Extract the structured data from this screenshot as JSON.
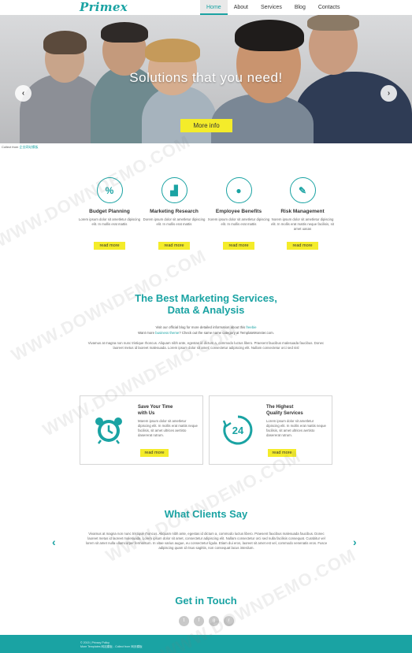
{
  "header": {
    "logo": "Primex",
    "nav": [
      "Home",
      "About",
      "Services",
      "Blog",
      "Contacts"
    ]
  },
  "hero": {
    "title": "Solutions that you need!",
    "button": "More info",
    "prev_icon": "chevron-left-icon",
    "next_icon": "chevron-right-icon",
    "prev_glyph": "‹",
    "next_glyph": "›"
  },
  "collect": {
    "prefix": "Collect from",
    "link": "企业网站模板"
  },
  "features": [
    {
      "icon": "percent-icon",
      "glyph": "%",
      "title": "Budget Planning",
      "text": "Lorem ipsum dolor sit ametletur dipiscing elit. In mollis erat mattis",
      "button": "read more"
    },
    {
      "icon": "bar-chart-icon",
      "glyph": "▟",
      "title": "Marketing Research",
      "text": "Dorem ipsum dolor sit ametletur dipiscing elit. In mollis erat mattis",
      "button": "read more"
    },
    {
      "icon": "user-icon",
      "glyph": "●",
      "title": "Employee Benefits",
      "text": "Xorem ipsum dolor sit ametletur dipiscing elit. In mollis erat mattis",
      "button": "read more"
    },
    {
      "icon": "wrench-icon",
      "glyph": "✎",
      "title": "Risk Management",
      "text": "Norem ipsum dolor sit ametletur dipiscing elit. In mollis erat mattis neque facilisis, sit amet uasas",
      "button": "read more"
    }
  ],
  "marketing": {
    "title_line1": "The Best Marketing Services,",
    "title_line2": "Data & Analysis",
    "line1_pre": "Visit our official blog for more detailed information about this",
    "line1_link": "freebie",
    "line2_pre": "Want more",
    "line2_link": "business theme",
    "line2_post": "? Check out the same name category at TemplateMonster.com.",
    "paragraph": "Vivamus at magna non nunc tristique rhoncus. Aliquam nibh ante, egestas id dictum a, commodo luctus libero. Praesent faucibus malesuada faucibus. Donec laoreet metus id laoreet malesuada. Lorem ipsum dolor sit amet, consectetur adipiscing elit. Nullam consectetur orci sed nisl"
  },
  "boxes": [
    {
      "icon": "alarm-clock-icon",
      "title_line1": "Save Your Time",
      "title_line2": "with Us",
      "text": "Marem ipsum dolor sit ametletur dipiscing elit. In mollis erat mattis neque facilisis, sit amet ultrices aertisto dasererat rutrum.",
      "button": "read more"
    },
    {
      "icon": "support-24-icon",
      "title_line1": "The Highest",
      "title_line2": "Quality Services",
      "text": "Lorem ipsum dolor sit ametletur dipiscing elit. In mollis erat mattis neque facilisis, sit amet ultrices aertisto dasererat rutrum.",
      "button": "read more"
    }
  ],
  "clients": {
    "title": "What Clients Say",
    "paragraph": "Vivamus at magna non nunc tristique rhoncus. Aliquam nibh ante, egestas id dictum a, commodo luctus libero. Praesent faucibus malesuada faucibus. Donec laoreet metus id laoreet malesuada. Lorem ipsum dolor sit amet, consectetur adipiscing elit. Nullam consectetur orci sed nulla facilisis consequat. Curabitur vel lorem sit amet nulla ullamcorper fermentum. In vitae varius augue, eu consectetur ligula. Etiam dui eros, laoreet sit amet est vel, commodo venenatis eros. Fusce adipiscing quam id risus sagittis, non consequat lacus interdum.",
    "prev_glyph": "‹",
    "next_glyph": "›"
  },
  "contact": {
    "title": "Get in Touch",
    "socials": [
      {
        "icon": "twitter-icon",
        "glyph": "t"
      },
      {
        "icon": "facebook-icon",
        "glyph": "f"
      },
      {
        "icon": "google-plus-icon",
        "glyph": "g"
      },
      {
        "icon": "rss-icon",
        "glyph": "r"
      }
    ]
  },
  "footer": {
    "line1": "© 2015 | Privacy Policy",
    "line2": "More Templates 网站模板 - Collect from 网页模板"
  },
  "watermark": "WWW.DOWNDEMO.COM",
  "colors": {
    "accent": "#1aa3a3",
    "button": "#f4ec2a",
    "footer": "#1aa3a3"
  }
}
